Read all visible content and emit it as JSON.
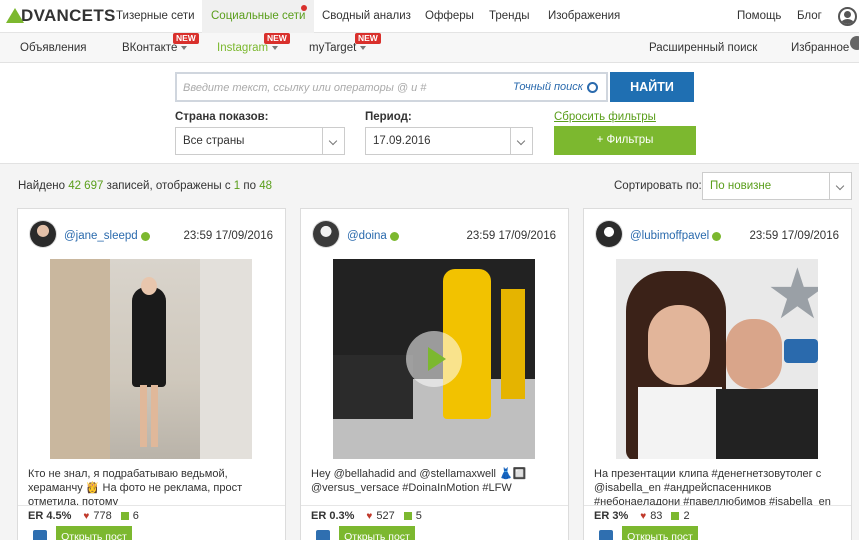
{
  "brand": {
    "logo_text": "DVANCETS",
    "accent": "#7cb82f",
    "link": "#2a6aad",
    "primary_button": "#1f6fb2"
  },
  "topnav": {
    "items": [
      "Тизерные сети",
      "Социальные сети",
      "Сводный анализ",
      "Офферы",
      "Тренды",
      "Изображения"
    ],
    "active_index": 1,
    "right": [
      "Помощь",
      "Блог"
    ]
  },
  "subnav": {
    "items": [
      "Объявления",
      "ВКонтакте",
      "Instagram",
      "myTarget"
    ],
    "active_index": 2,
    "new_badge": "NEW",
    "right": [
      "Расширенный поиск",
      "Избранное"
    ]
  },
  "search": {
    "placeholder": "Введите текст, ссылку или операторы @ и #",
    "exact_label": "Точный поиск",
    "find_button": "НАЙТИ"
  },
  "filters": {
    "country_label": "Страна показов:",
    "country_value": "Все страны",
    "period_label": "Период:",
    "period_value": "17.09.2016",
    "reset_label": "Сбросить фильтры",
    "filters_button": "+ Фильтры"
  },
  "results": {
    "found_prefix": "Найдено",
    "found_count": "42 697",
    "found_mid": "записей, отображены с",
    "from": "1",
    "to_word": "по",
    "to": "48",
    "sort_label": "Сортировать по:",
    "sort_value": "По новизне"
  },
  "cards": [
    {
      "handle": "@jane_sleepd",
      "time": "23:59 17/09/2016",
      "caption": "Кто не знал, я подрабатываю ведьмой, хераманчу 👸 На фото не реклама, прост отметила, потому",
      "er": "ER 4.5%",
      "likes": "778",
      "comments": "6",
      "open_label": "Открыть пост"
    },
    {
      "handle": "@doina",
      "time": "23:59 17/09/2016",
      "caption": "Hey @bellahadid and @stellamaxwell 👗🔲 @versus_versace #DoinaInMotion #LFW",
      "er": "ER 0.3%",
      "likes": "527",
      "comments": "5",
      "open_label": "Открыть пост"
    },
    {
      "handle": "@lubimoffpavel",
      "time": "23:59 17/09/2016",
      "caption": "На презентации клипа #денегнетзовутолег с @isabella_en #андрейспасенников #небонаeладони #павеллюбимов #isabella_en",
      "er": "ER 3%",
      "likes": "83",
      "comments": "2",
      "open_label": "Открыть пост"
    }
  ]
}
